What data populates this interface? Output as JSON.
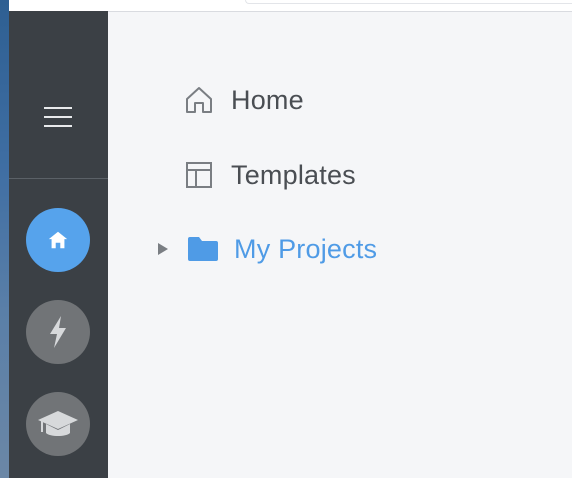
{
  "sidebar": {
    "menu_icon": "hamburger-menu-icon",
    "buttons": [
      {
        "name": "home",
        "icon": "home-icon",
        "color": "#56a3ec",
        "active": true
      },
      {
        "name": "quick-actions",
        "icon": "lightning-bolt-icon",
        "color": "#717477",
        "active": false
      },
      {
        "name": "learn",
        "icon": "graduation-cap-icon",
        "color": "#717477",
        "active": false
      }
    ]
  },
  "nav": {
    "home_label": "Home",
    "templates_label": "Templates",
    "projects_label": "My Projects"
  },
  "colors": {
    "accent": "#4f9be6",
    "rail_background": "#3b4045",
    "page_background": "#f5f6f8",
    "text": "#4a4e53"
  }
}
